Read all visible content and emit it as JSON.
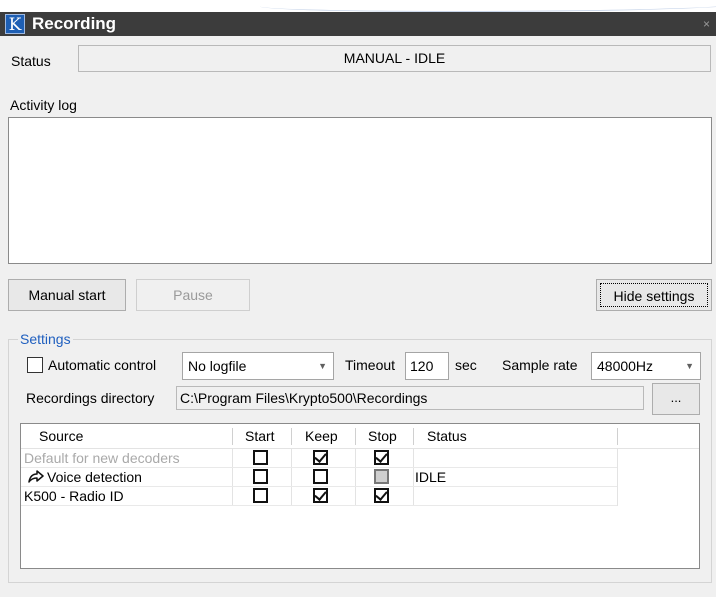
{
  "window": {
    "title": "Recording",
    "app_icon_letter": "K",
    "close_glyph": "×"
  },
  "status": {
    "label": "Status",
    "value": "MANUAL - IDLE"
  },
  "activity_log": {
    "label": "Activity log",
    "lines": []
  },
  "buttons": {
    "manual_start": "Manual start",
    "pause": "Pause",
    "hide_settings": "Hide settings"
  },
  "settings": {
    "legend": "Settings",
    "automatic_control": {
      "label": "Automatic control",
      "checked": false
    },
    "logfile": {
      "value": "No logfile"
    },
    "timeout": {
      "label": "Timeout",
      "value": "120",
      "unit": "sec"
    },
    "sample_rate": {
      "label": "Sample rate",
      "value": "48000Hz"
    },
    "recordings_directory": {
      "label": "Recordings directory",
      "value": "C:\\Program Files\\Krypto500\\Recordings",
      "browse_label": "..."
    }
  },
  "table": {
    "columns": [
      "Source",
      "Start",
      "Keep",
      "Stop",
      "Status"
    ],
    "rows": [
      {
        "source": "Default for new decoders",
        "start": false,
        "keep": true,
        "stop": true,
        "status": "",
        "greyed": true
      },
      {
        "source": "Voice detection",
        "start": false,
        "keep": false,
        "stop": "disabled",
        "status": "IDLE",
        "icon": "share-arrow-icon"
      },
      {
        "source": "K500 -  Radio ID",
        "start": false,
        "keep": true,
        "stop": true,
        "status": ""
      }
    ]
  }
}
